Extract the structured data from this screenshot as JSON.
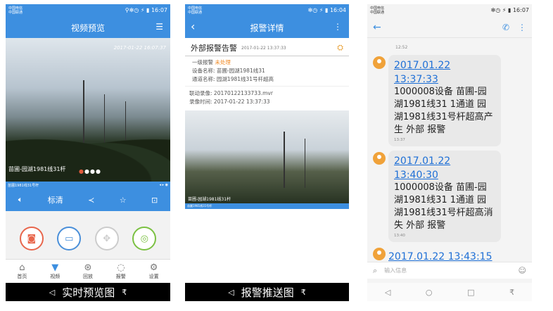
{
  "colors": {
    "accent": "#3d8fe0",
    "caption_bg": "#000000",
    "alarm_orange": "#f08a24",
    "link_blue": "#1e6fd6"
  },
  "panel1": {
    "status": {
      "left": "中国电信\n中国联通",
      "right": "⚲✻◷ ⚡︎ ▮ 16:07"
    },
    "title": "视频预览",
    "title_right_icon": "menu-icon",
    "video": {
      "timestamp": "2017-01-22 16:07:37",
      "caption": "苗圃-园湖1981线31杆",
      "strip_left": "苗圃1981线31号杆"
    },
    "controls": {
      "quality_label": "标清"
    },
    "nav": [
      {
        "label": "首页",
        "icon": "home-icon"
      },
      {
        "label": "视频",
        "icon": "camera-icon"
      },
      {
        "label": "回放",
        "icon": "playback-icon"
      },
      {
        "label": "报警",
        "icon": "alarm-icon"
      },
      {
        "label": "设置",
        "icon": "gear-icon"
      }
    ],
    "caption": "实时预览图"
  },
  "panel2": {
    "status": {
      "left": "中国电信\n中国联通",
      "right": "✻◷ ⚡︎ ▮ 16:04"
    },
    "title": "报警详情",
    "alarm": {
      "title": "外部报警告警",
      "time": "2017-01-22 13:37:33",
      "level_label": "一级报警",
      "state": "未处理",
      "device_label": "设备名称:",
      "device": "苗圃-园湖1981线31",
      "channel_label": "通道名称:",
      "channel": "园湖1981线31号杆超高",
      "record_label": "联动录像:",
      "record": "20170122133733.mvr",
      "record_time_label": "录像时间:",
      "record_time": "2017-01-22 13:37:33"
    },
    "video": {
      "caption": "苗圃-园湖1981线31杆",
      "strip": "苗圃1981线31号杆"
    },
    "caption": "报警推送图"
  },
  "panel3": {
    "status": {
      "left": "中国电信\n中国联通",
      "right": "✻◷ ⚡︎ ▮ 16:07"
    },
    "prev_meta": "12:52",
    "messages": [
      {
        "time_link": "2017.01.22 13:37:33",
        "body": "1000008设备 苗圃-园湖1981线31 1通道 园湖1981线31号杆超高产生 外部 报警",
        "meta": "13:37"
      },
      {
        "time_link": "2017.01.22 13:40:30",
        "body": "1000008设备 苗圃-园湖1981线31 1通道 园湖1981线31号杆超高消失 外部 报警",
        "meta": "13:40"
      },
      {
        "time_link": "2017.01.22 13:43:15",
        "body": "",
        "meta": ""
      }
    ],
    "input_placeholder": "输入信息"
  }
}
